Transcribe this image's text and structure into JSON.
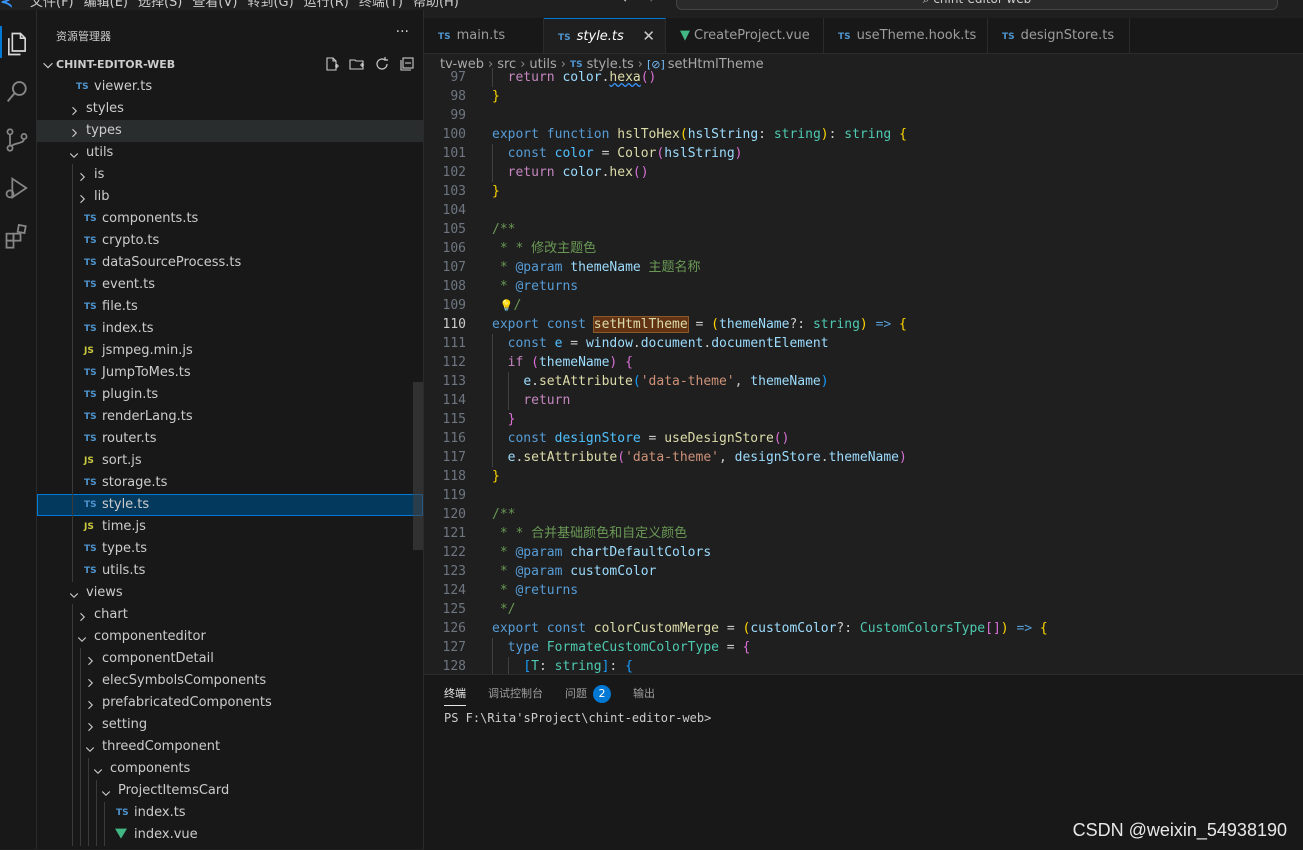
{
  "menubar": {
    "menus": [
      "文件(F)",
      "编辑(E)",
      "选择(S)",
      "查看(V)",
      "转到(G)",
      "运行(R)",
      "终端(T)",
      "帮助(H)"
    ],
    "nav_back": "←",
    "nav_forward": "→",
    "command_center": "chint-editor-web"
  },
  "sidebar": {
    "title": "资源管理器",
    "more": "···",
    "project": "CHINT-EDITOR-WEB",
    "tree": [
      {
        "label": "viewer.ts",
        "icon": "ts",
        "depth": 1,
        "type": "file"
      },
      {
        "label": "styles",
        "depth": 1,
        "type": "folder",
        "open": false
      },
      {
        "label": "types",
        "depth": 1,
        "type": "folder",
        "open": false,
        "state": "hover"
      },
      {
        "label": "utils",
        "depth": 1,
        "type": "folder",
        "open": true
      },
      {
        "label": "is",
        "depth": 2,
        "type": "folder",
        "open": false
      },
      {
        "label": "lib",
        "depth": 2,
        "type": "folder",
        "open": false
      },
      {
        "label": "components.ts",
        "icon": "ts",
        "depth": 2,
        "type": "file"
      },
      {
        "label": "crypto.ts",
        "icon": "ts",
        "depth": 2,
        "type": "file"
      },
      {
        "label": "dataSourceProcess.ts",
        "icon": "ts",
        "depth": 2,
        "type": "file"
      },
      {
        "label": "event.ts",
        "icon": "ts",
        "depth": 2,
        "type": "file"
      },
      {
        "label": "file.ts",
        "icon": "ts",
        "depth": 2,
        "type": "file"
      },
      {
        "label": "index.ts",
        "icon": "ts",
        "depth": 2,
        "type": "file"
      },
      {
        "label": "jsmpeg.min.js",
        "icon": "js",
        "depth": 2,
        "type": "file"
      },
      {
        "label": "JumpToMes.ts",
        "icon": "ts",
        "depth": 2,
        "type": "file"
      },
      {
        "label": "plugin.ts",
        "icon": "ts",
        "depth": 2,
        "type": "file"
      },
      {
        "label": "renderLang.ts",
        "icon": "ts",
        "depth": 2,
        "type": "file"
      },
      {
        "label": "router.ts",
        "icon": "ts",
        "depth": 2,
        "type": "file"
      },
      {
        "label": "sort.js",
        "icon": "js",
        "depth": 2,
        "type": "file"
      },
      {
        "label": "storage.ts",
        "icon": "ts",
        "depth": 2,
        "type": "file"
      },
      {
        "label": "style.ts",
        "icon": "ts",
        "depth": 2,
        "type": "file",
        "state": "selected"
      },
      {
        "label": "time.js",
        "icon": "js",
        "depth": 2,
        "type": "file"
      },
      {
        "label": "type.ts",
        "icon": "ts",
        "depth": 2,
        "type": "file"
      },
      {
        "label": "utils.ts",
        "icon": "ts",
        "depth": 2,
        "type": "file"
      },
      {
        "label": "views",
        "depth": 1,
        "type": "folder",
        "open": true
      },
      {
        "label": "chart",
        "depth": 2,
        "type": "folder",
        "open": false
      },
      {
        "label": "componenteditor",
        "depth": 2,
        "type": "folder",
        "open": true
      },
      {
        "label": "componentDetail",
        "depth": 3,
        "type": "folder",
        "open": false
      },
      {
        "label": "elecSymbolsComponents",
        "depth": 3,
        "type": "folder",
        "open": false
      },
      {
        "label": "prefabricatedComponents",
        "depth": 3,
        "type": "folder",
        "open": false
      },
      {
        "label": "setting",
        "depth": 3,
        "type": "folder",
        "open": false
      },
      {
        "label": "threedComponent",
        "depth": 3,
        "type": "folder",
        "open": true
      },
      {
        "label": "components",
        "depth": 4,
        "type": "folder",
        "open": true
      },
      {
        "label": "ProjectItemsCard",
        "depth": 5,
        "type": "folder",
        "open": true
      },
      {
        "label": "index.ts",
        "icon": "ts",
        "depth": 6,
        "type": "file"
      },
      {
        "label": "index.vue",
        "icon": "vue",
        "depth": 6,
        "type": "file"
      }
    ]
  },
  "tabs": [
    {
      "label": "main.ts",
      "icon": "ts",
      "italic": false
    },
    {
      "label": "style.ts",
      "icon": "ts",
      "italic": true,
      "active": true,
      "close": "✕"
    },
    {
      "label": "CreateProject.vue",
      "icon": "vue",
      "italic": false
    },
    {
      "label": "useTheme.hook.ts",
      "icon": "ts",
      "italic": false
    },
    {
      "label": "designStore.ts",
      "icon": "ts",
      "italic": false
    }
  ],
  "breadcrumb": [
    "tv-web",
    "src",
    "utils",
    "style.ts",
    "setHtmlTheme"
  ],
  "code": {
    "current_line": 110,
    "lines": [
      {
        "n": 97,
        "tokens": [
          [
            "  ",
            ""
          ],
          [
            "return",
            "ctl"
          ],
          [
            " ",
            ""
          ],
          [
            "color",
            "v"
          ],
          [
            ".",
            ""
          ],
          [
            "hexa",
            "fn squig"
          ],
          [
            "()",
            "p2"
          ]
        ]
      },
      {
        "n": 98,
        "tokens": [
          [
            "}",
            "p1"
          ]
        ]
      },
      {
        "n": 99,
        "tokens": []
      },
      {
        "n": 100,
        "tokens": [
          [
            "export",
            "kw"
          ],
          [
            " ",
            ""
          ],
          [
            "function",
            "kw"
          ],
          [
            " ",
            ""
          ],
          [
            "hslToHex",
            "fn"
          ],
          [
            "(",
            "p1"
          ],
          [
            "hslString",
            "v"
          ],
          [
            ": ",
            ""
          ],
          [
            "string",
            "ty"
          ],
          [
            ")",
            "p1"
          ],
          [
            ": ",
            ""
          ],
          [
            "string",
            "ty"
          ],
          [
            " ",
            ""
          ],
          [
            "{",
            "p1"
          ]
        ]
      },
      {
        "n": 101,
        "tokens": [
          [
            "  ",
            ""
          ],
          [
            "const",
            "kw"
          ],
          [
            " ",
            ""
          ],
          [
            "color",
            "cv"
          ],
          [
            " = ",
            ""
          ],
          [
            "Color",
            "fn"
          ],
          [
            "(",
            "p2"
          ],
          [
            "hslString",
            "v"
          ],
          [
            ")",
            "p2"
          ]
        ]
      },
      {
        "n": 102,
        "tokens": [
          [
            "  ",
            ""
          ],
          [
            "return",
            "ctl"
          ],
          [
            " ",
            ""
          ],
          [
            "color",
            "v"
          ],
          [
            ".",
            ""
          ],
          [
            "hex",
            "fn"
          ],
          [
            "()",
            "p2"
          ]
        ]
      },
      {
        "n": 103,
        "tokens": [
          [
            "}",
            "p1"
          ]
        ]
      },
      {
        "n": 104,
        "tokens": []
      },
      {
        "n": 105,
        "tokens": [
          [
            "/**",
            "cm"
          ]
        ]
      },
      {
        "n": 106,
        "tokens": [
          [
            " * * 修改主题色",
            "cm"
          ]
        ]
      },
      {
        "n": 107,
        "tokens": [
          [
            " * ",
            "cm"
          ],
          [
            "@param",
            "kw"
          ],
          [
            " ",
            "cm"
          ],
          [
            "themeName",
            "v"
          ],
          [
            " 主题名称",
            "cm"
          ]
        ]
      },
      {
        "n": 108,
        "tokens": [
          [
            " * ",
            "cm"
          ],
          [
            "@returns",
            "kw"
          ]
        ]
      },
      {
        "n": 109,
        "tokens": [
          [
            " ",
            ""
          ],
          [
            "💡",
            "bulb"
          ],
          [
            "/",
            "cm"
          ]
        ]
      },
      {
        "n": 110,
        "tokens": [
          [
            "export",
            "kw"
          ],
          [
            " ",
            ""
          ],
          [
            "const",
            "kw"
          ],
          [
            " ",
            ""
          ],
          [
            "setHtmlTheme",
            "fn hl"
          ],
          [
            " = ",
            ""
          ],
          [
            "(",
            "p1"
          ],
          [
            "themeName",
            "v"
          ],
          [
            "?: ",
            ""
          ],
          [
            "string",
            "ty"
          ],
          [
            ")",
            "p1"
          ],
          [
            " ",
            ""
          ],
          [
            "=>",
            "kw"
          ],
          [
            " ",
            ""
          ],
          [
            "{",
            "p1"
          ]
        ]
      },
      {
        "n": 111,
        "tokens": [
          [
            "  ",
            ""
          ],
          [
            "const",
            "kw"
          ],
          [
            " ",
            ""
          ],
          [
            "e",
            "cv"
          ],
          [
            " = ",
            ""
          ],
          [
            "window",
            "v"
          ],
          [
            ".",
            ""
          ],
          [
            "document",
            "v"
          ],
          [
            ".",
            ""
          ],
          [
            "documentElement",
            "v"
          ]
        ]
      },
      {
        "n": 112,
        "tokens": [
          [
            "  ",
            ""
          ],
          [
            "if",
            "ctl"
          ],
          [
            " ",
            ""
          ],
          [
            "(",
            "p2"
          ],
          [
            "themeName",
            "v"
          ],
          [
            ")",
            "p2"
          ],
          [
            " ",
            ""
          ],
          [
            "{",
            "p2"
          ]
        ]
      },
      {
        "n": 113,
        "tokens": [
          [
            "    ",
            ""
          ],
          [
            "e",
            "v"
          ],
          [
            ".",
            ""
          ],
          [
            "setAttribute",
            "fn"
          ],
          [
            "(",
            "p3"
          ],
          [
            "'data-theme'",
            "st"
          ],
          [
            ", ",
            ""
          ],
          [
            "themeName",
            "v"
          ],
          [
            ")",
            "p3"
          ]
        ]
      },
      {
        "n": 114,
        "tokens": [
          [
            "    ",
            ""
          ],
          [
            "return",
            "ctl"
          ]
        ]
      },
      {
        "n": 115,
        "tokens": [
          [
            "  ",
            ""
          ],
          [
            "}",
            "p2"
          ]
        ]
      },
      {
        "n": 116,
        "tokens": [
          [
            "  ",
            ""
          ],
          [
            "const",
            "kw"
          ],
          [
            " ",
            ""
          ],
          [
            "designStore",
            "cv"
          ],
          [
            " = ",
            ""
          ],
          [
            "useDesignStore",
            "fn"
          ],
          [
            "()",
            "p2"
          ]
        ]
      },
      {
        "n": 117,
        "tokens": [
          [
            "  ",
            ""
          ],
          [
            "e",
            "v"
          ],
          [
            ".",
            ""
          ],
          [
            "setAttribute",
            "fn"
          ],
          [
            "(",
            "p2"
          ],
          [
            "'data-theme'",
            "st"
          ],
          [
            ", ",
            ""
          ],
          [
            "designStore",
            "v"
          ],
          [
            ".",
            ""
          ],
          [
            "themeName",
            "v"
          ],
          [
            ")",
            "p2"
          ]
        ]
      },
      {
        "n": 118,
        "tokens": [
          [
            "}",
            "p1"
          ]
        ]
      },
      {
        "n": 119,
        "tokens": []
      },
      {
        "n": 120,
        "tokens": [
          [
            "/**",
            "cm"
          ]
        ]
      },
      {
        "n": 121,
        "tokens": [
          [
            " * * 合并基础颜色和自定义颜色",
            "cm"
          ]
        ]
      },
      {
        "n": 122,
        "tokens": [
          [
            " * ",
            "cm"
          ],
          [
            "@param",
            "kw"
          ],
          [
            " ",
            "cm"
          ],
          [
            "chartDefaultColors",
            "v"
          ]
        ]
      },
      {
        "n": 123,
        "tokens": [
          [
            " * ",
            "cm"
          ],
          [
            "@param",
            "kw"
          ],
          [
            " ",
            "cm"
          ],
          [
            "customColor",
            "v"
          ]
        ]
      },
      {
        "n": 124,
        "tokens": [
          [
            " * ",
            "cm"
          ],
          [
            "@returns",
            "kw"
          ]
        ]
      },
      {
        "n": 125,
        "tokens": [
          [
            " */",
            "cm"
          ]
        ]
      },
      {
        "n": 126,
        "tokens": [
          [
            "export",
            "kw"
          ],
          [
            " ",
            ""
          ],
          [
            "const",
            "kw"
          ],
          [
            " ",
            ""
          ],
          [
            "colorCustomMerge",
            "fn"
          ],
          [
            " = ",
            ""
          ],
          [
            "(",
            "p1"
          ],
          [
            "customColor",
            "v"
          ],
          [
            "?: ",
            ""
          ],
          [
            "CustomColorsType",
            "ty"
          ],
          [
            "[]",
            "p2"
          ],
          [
            ")",
            "p1"
          ],
          [
            " ",
            ""
          ],
          [
            "=>",
            "kw"
          ],
          [
            " ",
            ""
          ],
          [
            "{",
            "p1"
          ]
        ]
      },
      {
        "n": 127,
        "tokens": [
          [
            "  ",
            ""
          ],
          [
            "type",
            "kw"
          ],
          [
            " ",
            ""
          ],
          [
            "FormateCustomColorType",
            "ty"
          ],
          [
            " = ",
            ""
          ],
          [
            "{",
            "p2"
          ]
        ]
      },
      {
        "n": 128,
        "tokens": [
          [
            "    ",
            ""
          ],
          [
            "[",
            "p3"
          ],
          [
            "T",
            "ty"
          ],
          [
            ": ",
            ""
          ],
          [
            "string",
            "ty"
          ],
          [
            "]",
            "p3"
          ],
          [
            ": ",
            ""
          ],
          [
            "{",
            "p3"
          ]
        ]
      }
    ]
  },
  "panel": {
    "tabs": [
      "终端",
      "调试控制台",
      "问题",
      "输出"
    ],
    "problems_count": "2",
    "terminal_line": "PS F:\\Rita'sProject\\chint-editor-web>"
  },
  "watermark": "CSDN @weixin_54938190"
}
